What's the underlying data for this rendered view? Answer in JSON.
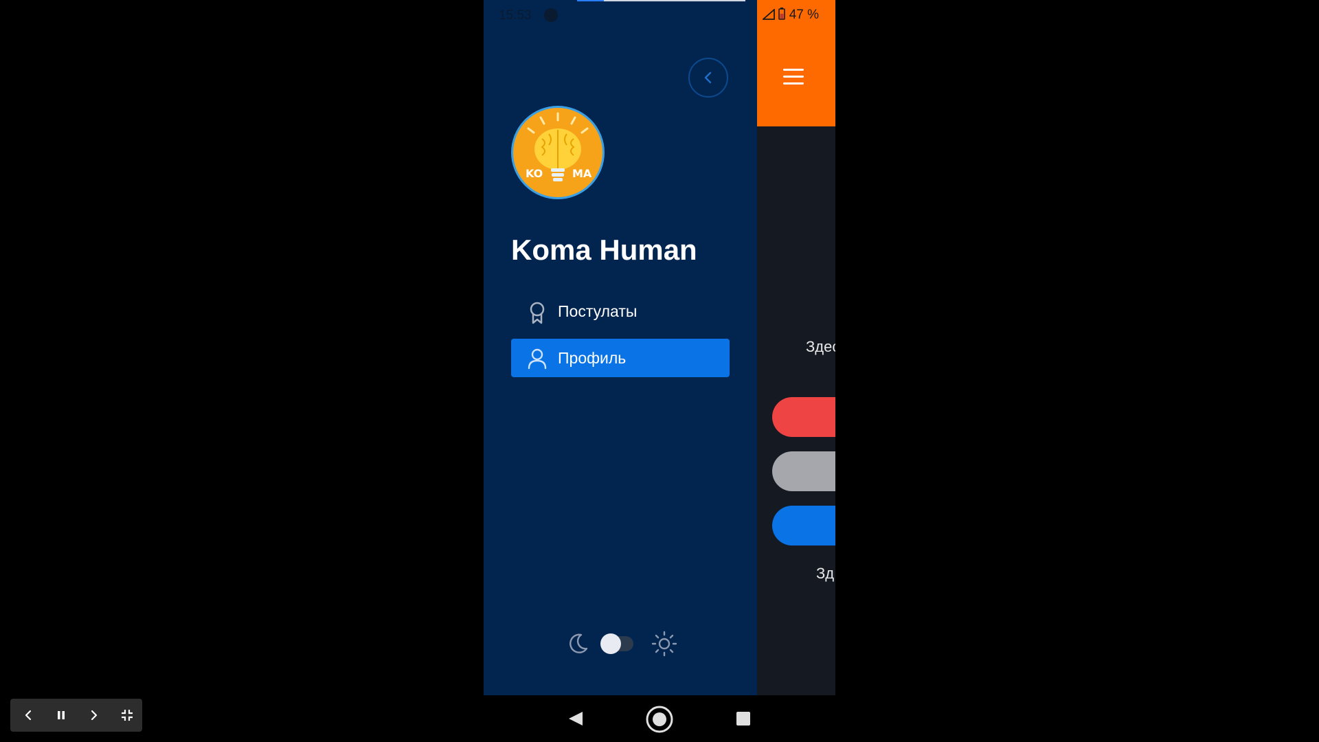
{
  "status_bar": {
    "time": "15:53",
    "battery": "47 %",
    "load_progress_fraction": 0.16
  },
  "drawer": {
    "user_name": "Koma Human",
    "avatar_text_left": "KO",
    "avatar_text_right": "MA",
    "menu": [
      {
        "label": "Постулаты",
        "icon": "award-icon",
        "active": false
      },
      {
        "label": "Профиль",
        "icon": "user-icon",
        "active": true
      }
    ],
    "theme": {
      "mode": "dark"
    }
  },
  "main": {
    "text_1": "Здес",
    "text_2": "Зд"
  },
  "colors": {
    "drawer_bg": "#022550",
    "accent": "#0a74e6",
    "header_orange": "#ff6a00",
    "main_bg": "#151a22",
    "pill_red": "#ef4444",
    "pill_gray": "#a6a7ad",
    "pill_blue": "#0a74e6"
  }
}
